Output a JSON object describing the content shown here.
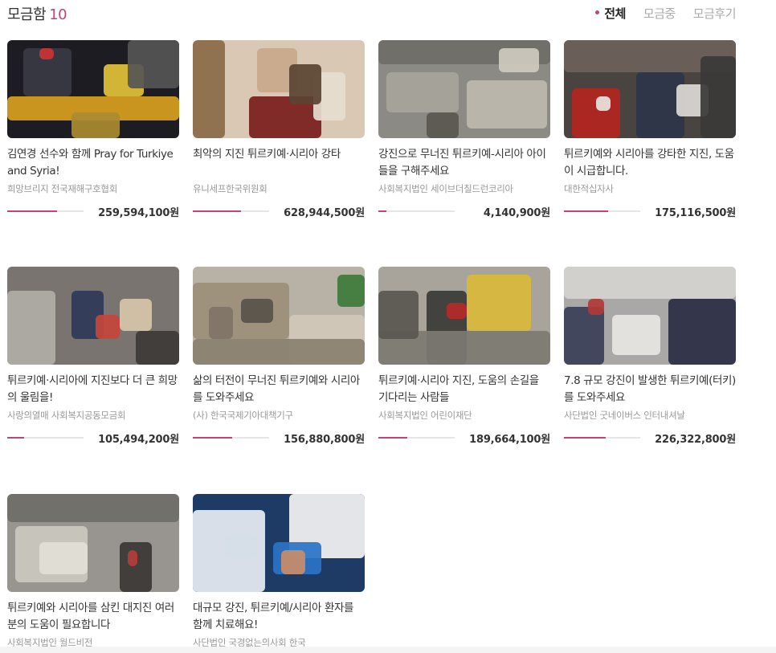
{
  "header": {
    "title": "모금함",
    "count": "10",
    "filters": [
      {
        "label": "전체",
        "active": true
      },
      {
        "label": "모금중",
        "active": false
      },
      {
        "label": "모금후기",
        "active": false
      }
    ]
  },
  "cards": [
    {
      "title": "김연경 선수와 함께 Pray for Turkiye and Syria!",
      "org": "희망브리지 전국재해구호협회",
      "amount": "259,594,100원",
      "progress": 0.65,
      "image": "rescue-workers-night"
    },
    {
      "title": "최악의 지진 튀르키예·시리아 강타",
      "org": "유니세프한국위원회",
      "amount": "628,944,500원",
      "progress": 0.63,
      "image": "man-holding-child"
    },
    {
      "title": "강진으로 무너진 튀르키예-시리아 아이들을 구해주세요",
      "org": "사회복지법인 세이브더칠드런코리아",
      "amount": "4,140,900원",
      "progress": 0.1,
      "image": "aerial-collapsed-buildings"
    },
    {
      "title": "튀르키예와 시리아를 강타한 지진, 도움이 시급합니다.",
      "org": "대한적십자사",
      "amount": "175,116,500원",
      "progress": 0.58,
      "image": "red-crescent-rescue"
    },
    {
      "title": "튀르키예·시리아에 지진보다 더 큰 희망의 울림을!",
      "org": "사랑의열매 사회복지공동모금회",
      "amount": "105,494,200원",
      "progress": 0.22,
      "image": "rescuers-in-rubble"
    },
    {
      "title": "삶의 터전이 무너진 튀르키예와 시리아를 도와주세요",
      "org": "(사) 한국국제기아대책기구",
      "amount": "156,880,800원",
      "progress": 0.52,
      "image": "destroyed-building"
    },
    {
      "title": "튀르키예·시리아 지진, 도움의 손길을 기다리는 사람들",
      "org": "사회복지법인 어린이재단",
      "amount": "189,664,100원",
      "progress": 0.38,
      "image": "man-carrying-child-street"
    },
    {
      "title": "7.8 규모 강진이 발생한 튀르키예(터키)를 도와주세요",
      "org": "사단법인 굿네이버스 인터내셔날",
      "amount": "226,322,800원",
      "progress": 0.55,
      "image": "crowd-at-collapse"
    },
    {
      "title": "튀르키예와 시리아를 삼킨 대지진 여러분의 도움이 필요합니다",
      "org": "사회복지법인 월드비전",
      "amount": "",
      "progress": 0,
      "image": "collapsed-slabs"
    },
    {
      "title": "대규모 강진, 튀르키예/시리아 환자를 함께 치료해요!",
      "org": "사단법인 국경없는의사회 한국",
      "amount": "",
      "progress": 0,
      "image": "medics-treating-patient"
    }
  ],
  "colors": {
    "accent": "#c2427b",
    "track": "#e6e6e6"
  }
}
